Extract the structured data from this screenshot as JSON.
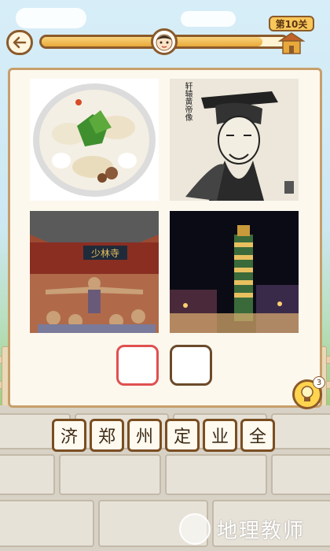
{
  "level": {
    "label": "第10关"
  },
  "progress": {
    "fraction": 0.9
  },
  "pictures": [
    {
      "subject": "dumplings-soup",
      "description": "bowl of dumplings with cilantro"
    },
    {
      "subject": "ink-portrait",
      "caption": "轩辕黄帝像"
    },
    {
      "subject": "shaolin-temple",
      "sign": "少林寺"
    },
    {
      "subject": "city-night-tower"
    }
  ],
  "answer_slots": [
    {
      "value": ""
    },
    {
      "value": ""
    }
  ],
  "hint": {
    "count": "3"
  },
  "letters": [
    "济",
    "郑",
    "州",
    "定",
    "业",
    "全"
  ],
  "watermark": {
    "text": "地理教师"
  },
  "colors": {
    "brown": "#8b5a2b",
    "gold": "#f8c75a",
    "slot_red": "#e05050",
    "slot_brown": "#6b4a2a"
  }
}
